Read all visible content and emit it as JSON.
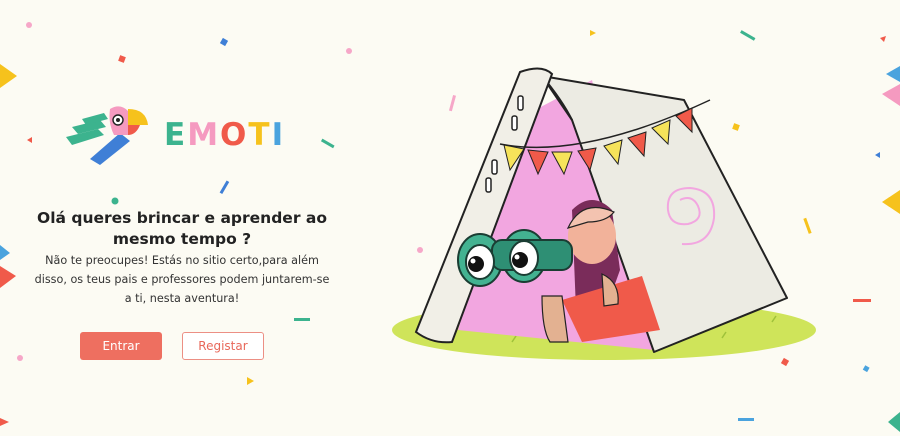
{
  "brand": {
    "name_letters": [
      {
        "char": "E",
        "color": "#3cb38e"
      },
      {
        "char": "M",
        "color": "#f59ac0"
      },
      {
        "char": "O",
        "color": "#f05a4a"
      },
      {
        "char": "T",
        "color": "#f6c21c"
      },
      {
        "char": "I",
        "color": "#4aa3de"
      }
    ]
  },
  "hero": {
    "headline": "Olá queres brincar e aprender ao mesmo tempo ?",
    "subtitle": "Não te preocupes! Estás no sitio certo,para além disso, os teus pais e professores podem juntarem-se a ti, nesta aventura!"
  },
  "actions": {
    "login_label": "Entrar",
    "register_label": "Registar"
  },
  "colors": {
    "background": "#fcfbf3",
    "primary": "#ee6f60",
    "secondary_border": "#ec8f84"
  },
  "icons": {
    "logo": "parrot-logo-icon",
    "hero": "child-in-tent-with-binoculars-illustration"
  }
}
